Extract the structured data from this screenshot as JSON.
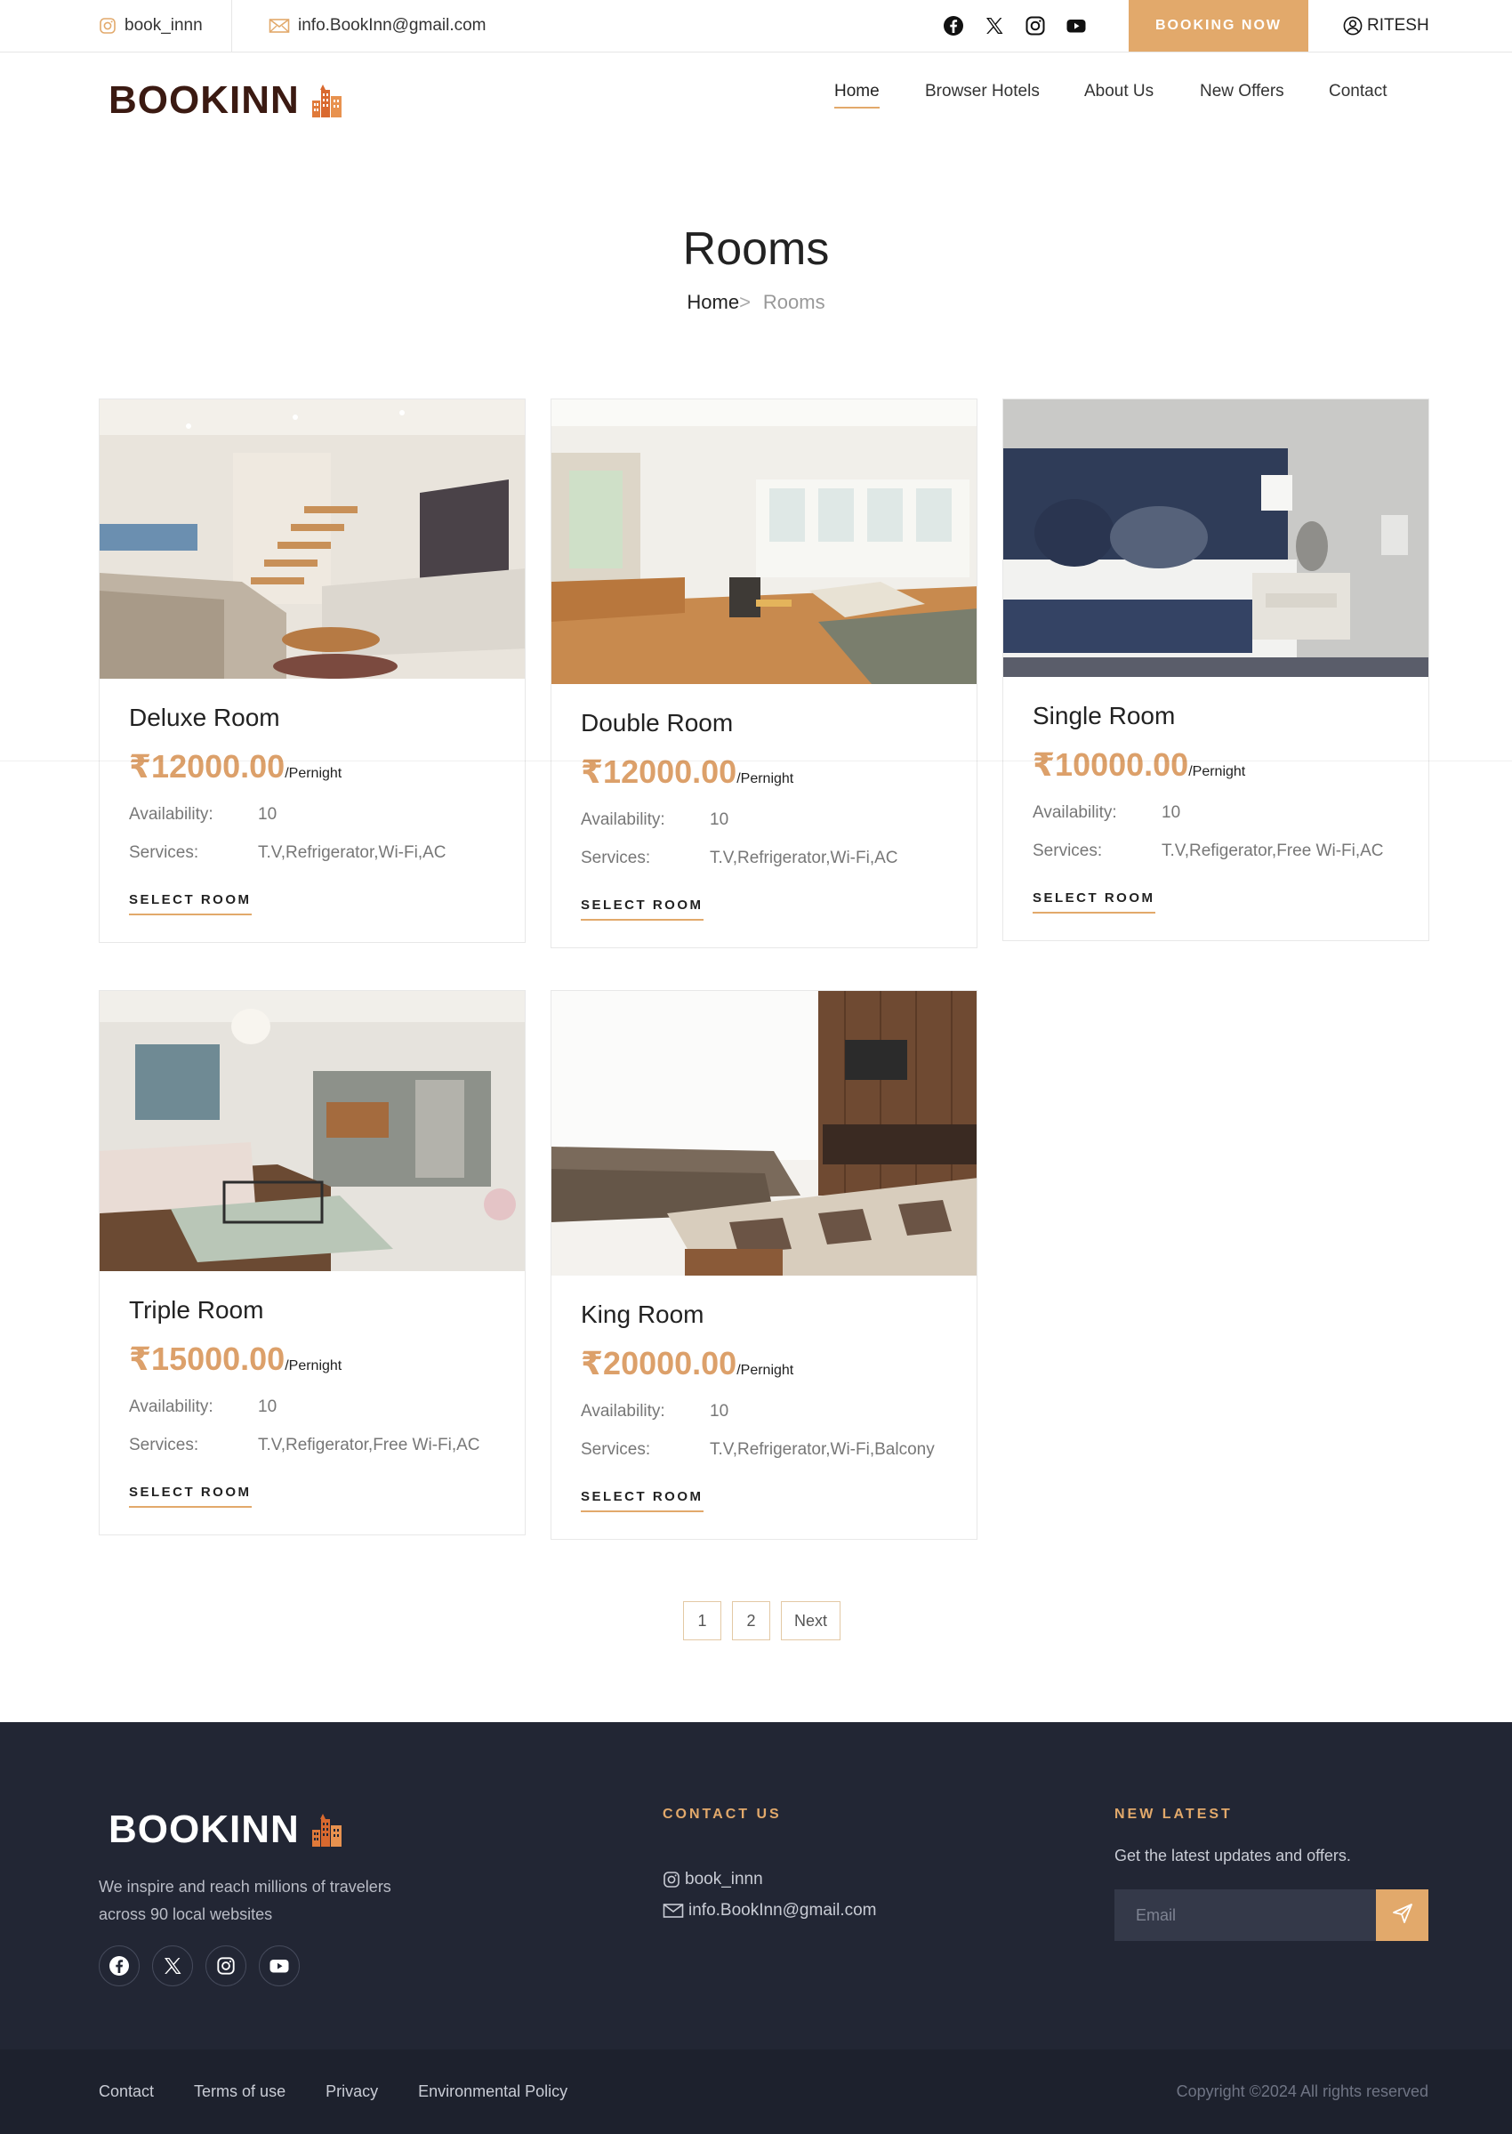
{
  "topbar": {
    "instagram_handle": "book_innn",
    "email": "info.BookInn@gmail.com",
    "booking_button": "BOOKING NOW",
    "user_name": "RITESH"
  },
  "brand": {
    "logo_text": "BOOKINN",
    "accent_color": "#e2a96b",
    "logo_color": "#3b1a12"
  },
  "nav": {
    "items": [
      "Home",
      "Browser Hotels",
      "About Us",
      "New Offers",
      "Contact"
    ],
    "active": "Home"
  },
  "page": {
    "title": "Rooms",
    "breadcrumb_home": "Home",
    "breadcrumb_sep": ">",
    "breadcrumb_current": "Rooms"
  },
  "labels": {
    "availability": "Availability:",
    "services": "Services:",
    "select_room": "SELECT ROOM",
    "per_night": "/Pernight"
  },
  "rooms": [
    {
      "name": "Deluxe Room",
      "price": "₹12000.00",
      "availability": "10",
      "services": "T.V,Refrigerator,Wi-Fi,AC",
      "image": "living-room-with-staircase"
    },
    {
      "name": "Double Room",
      "price": "₹12000.00",
      "availability": "10",
      "services": "T.V,Refrigerator,Wi-Fi,AC",
      "image": "bright-living-room-wood-floor"
    },
    {
      "name": "Single Room",
      "price": "₹10000.00",
      "availability": "10",
      "services": "T.V,Refigerator,Free Wi-Fi,AC",
      "image": "bedroom-navy-headboard"
    },
    {
      "name": "Triple Room",
      "price": "₹15000.00",
      "availability": "10",
      "services": "T.V,Refigerator,Free Wi-Fi,AC",
      "image": "living-room-sectional-sofa"
    },
    {
      "name": "King Room",
      "price": "₹20000.00",
      "availability": "10",
      "services": "T.V,Refrigerator,Wi-Fi,Balcony",
      "image": "lounge-brown-sofa-tv-wall"
    }
  ],
  "pagination": {
    "pages": [
      "1",
      "2"
    ],
    "next": "Next"
  },
  "footer": {
    "logo_text": "BOOKINN",
    "tagline_line1": "We inspire and reach millions of travelers",
    "tagline_line2": "across 90 local websites",
    "contact_heading": "CONTACT US",
    "contact_instagram": "book_innn",
    "contact_email": "info.BookInn@gmail.com",
    "news_heading": "NEW LATEST",
    "news_text": "Get the latest updates and offers.",
    "email_placeholder": "Email",
    "links": [
      "Contact",
      "Terms of use",
      "Privacy",
      "Environmental Policy"
    ],
    "copyright": "Copyright ©2024 All rights reserved"
  },
  "icons": {
    "social": [
      "facebook-icon",
      "x-icon",
      "instagram-icon",
      "youtube-icon"
    ],
    "send": "send-icon",
    "user": "user-circle-icon",
    "mail": "mail-icon"
  }
}
